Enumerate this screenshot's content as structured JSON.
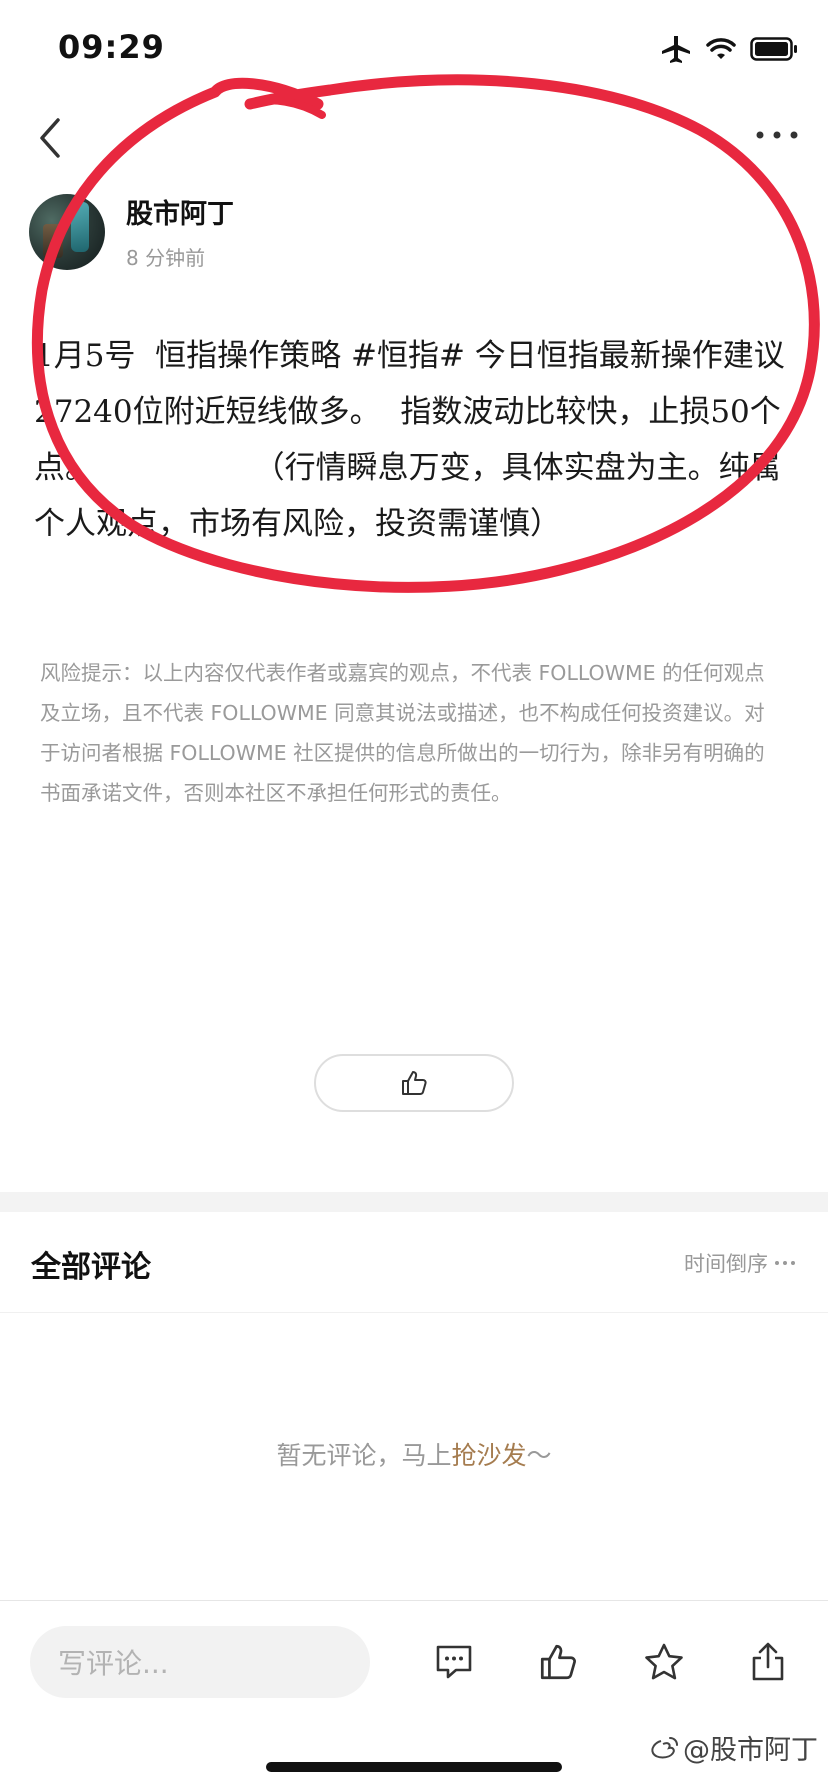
{
  "status_bar": {
    "time": "09:29"
  },
  "author": {
    "name": "股市阿丁",
    "time": "8 分钟前"
  },
  "post": {
    "body": "1月5号  恒指操作策略 #恒指# 今日恒指最新操作建议 27240位附近短线做多。  指数波动比较快，止损50个点。                （行情瞬息万变，具体实盘为主。纯属个人观点，市场有风险，投资需谨慎）"
  },
  "disclaimer": "风险提示：以上内容仅代表作者或嘉宾的观点，不代表 FOLLOWME 的任何观点及立场，且不代表 FOLLOWME 同意其说法或描述，也不构成任何投资建议。对于访问者根据 FOLLOWME 社区提供的信息所做出的一切行为，除非另有明确的书面承诺文件，否则本社区不承担任何形式的责任。",
  "comments": {
    "title": "全部评论",
    "sort_label": "时间倒序",
    "empty_prefix": "暂无评论，马上",
    "empty_link": "抢沙发",
    "empty_suffix": "～"
  },
  "bottom_bar": {
    "input_placeholder": "写评论..."
  },
  "watermark": "@股市阿丁",
  "icons": {
    "back": "chevron-left-icon",
    "more": "more-dots-icon",
    "like": "thumbs-up-icon",
    "comment": "chat-bubble-icon",
    "favorite": "star-icon",
    "share": "share-icon"
  },
  "colors": {
    "annotation": "#e8283f",
    "link": "#a57c4f"
  }
}
